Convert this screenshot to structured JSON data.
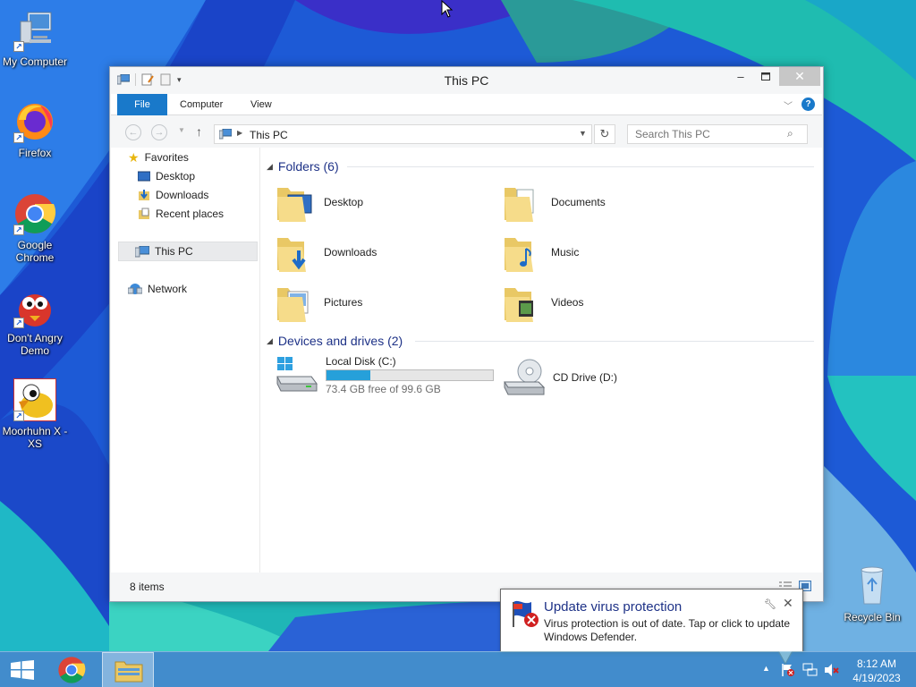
{
  "desktop": {
    "icons": [
      {
        "label": "My Computer"
      },
      {
        "label": "Firefox"
      },
      {
        "label": "Google Chrome"
      },
      {
        "label": "Don't Angry Demo"
      },
      {
        "label": "Moorhuhn X - XS"
      },
      {
        "label": "Recycle Bin"
      }
    ]
  },
  "window": {
    "title": "This PC",
    "ribbon": {
      "file": "File",
      "computer": "Computer",
      "view": "View"
    },
    "address": "This PC",
    "search_placeholder": "Search This PC",
    "nav": {
      "favorites": "Favorites",
      "desktop": "Desktop",
      "downloads": "Downloads",
      "recent": "Recent places",
      "this_pc": "This PC",
      "network": "Network"
    },
    "folders_header": "Folders (6)",
    "folders": [
      {
        "name": "Desktop",
        "icon": "desktop-folder-icon"
      },
      {
        "name": "Documents",
        "icon": "documents-folder-icon"
      },
      {
        "name": "Downloads",
        "icon": "downloads-folder-icon"
      },
      {
        "name": "Music",
        "icon": "music-folder-icon"
      },
      {
        "name": "Pictures",
        "icon": "pictures-folder-icon"
      },
      {
        "name": "Videos",
        "icon": "videos-folder-icon"
      }
    ],
    "devices_header": "Devices and drives (2)",
    "drives": [
      {
        "name": "Local Disk (C:)",
        "free": "73.4 GB free of 99.6 GB",
        "used_fraction": 0.263
      },
      {
        "name": "CD Drive (D:)"
      }
    ],
    "status": "8 items"
  },
  "notification": {
    "title": "Update virus protection",
    "message": "Virus protection is out of date. Tap or click to update Windows Defender."
  },
  "taskbar": {
    "time": "8:12 AM",
    "date": "4/19/2023"
  },
  "colors": {
    "accent": "#1979ca",
    "link_blue": "#1e3287",
    "progress": "#26a0da"
  }
}
